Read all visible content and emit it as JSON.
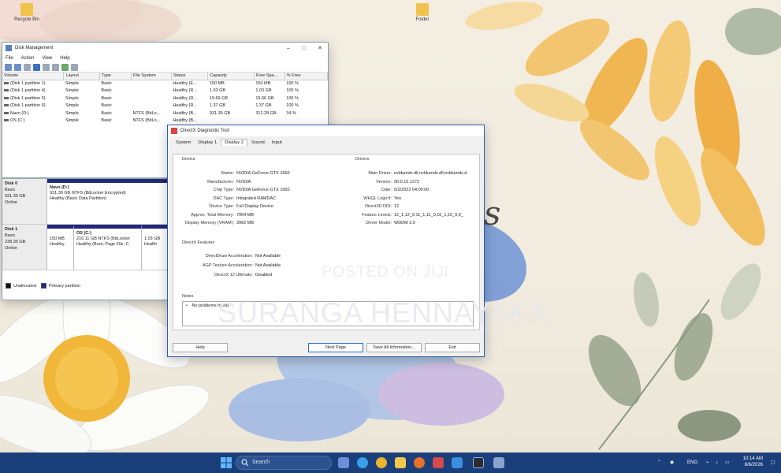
{
  "desktop": {
    "icons": [
      {
        "label": "Recycle Bin",
        "icon": "recycle-bin-icon"
      },
      {
        "label": "Folder",
        "icon": "folder-icon"
      }
    ],
    "wallpaper_text": "ts",
    "watermark_posted": "POSTED ON JIJI",
    "watermark_name": "SURANGA HENNAYAKA"
  },
  "disk_management": {
    "title": "Disk Management",
    "menu": [
      "File",
      "Action",
      "View",
      "Help"
    ],
    "columns": [
      "Volume",
      "Layout",
      "Type",
      "File System",
      "Status",
      "Capacity",
      "Free Spa...",
      "% Free"
    ],
    "rows": [
      [
        "(Disk 1 partition 1)",
        "Simple",
        "Basic",
        "",
        "Healthy (E...",
        "150 MB",
        "150 MB",
        "100 %"
      ],
      [
        "(Disk 1 partition 4)",
        "Simple",
        "Basic",
        "",
        "Healthy (R...",
        "1.03 GB",
        "1.03 GB",
        "100 %"
      ],
      [
        "(Disk 1 partition 5)",
        "Simple",
        "Basic",
        "",
        "Healthy (R...",
        "19.66 GB",
        "19.66 GB",
        "100 %"
      ],
      [
        "(Disk 1 partition 6)",
        "Simple",
        "Basic",
        "",
        "Healthy (R...",
        "1.37 GB",
        "1.37 GB",
        "100 %"
      ],
      [
        "Navo (D:)",
        "Simple",
        "Basic",
        "NTFS (BitLo...",
        "Healthy (B...",
        "931.39 GB",
        "312.28 GB",
        "34 %"
      ],
      [
        "OS (C:)",
        "Simple",
        "Basic",
        "NTFS (BitLo...",
        "Healthy (B...",
        "",
        "",
        ""
      ]
    ],
    "disk0": {
      "name": "Disk 0",
      "type": "Basic",
      "size": "931.39 GB",
      "state": "Online",
      "part_name": "Navo (D:)",
      "part_size": "931.39 GB NTFS (BitLocker Encrypted)",
      "part_status": "Healthy (Basic Data Partition)"
    },
    "disk1": {
      "name": "Disk 1",
      "type": "Basic",
      "size": "238.35 GB",
      "state": "Online",
      "p1_size": "150 MB",
      "p1_status": "Healthy",
      "p2_name": "OS (C:)",
      "p2_size": "216.11 GB NTFS (BitLocker",
      "p2_status": "Healthy (Boot, Page File, C",
      "p3_size": "1.03 GB",
      "p3_status": "Health"
    },
    "legend": [
      "Unallocated",
      "Primary partition"
    ]
  },
  "dxdiag": {
    "title": "DirectX Diagnostic Tool",
    "tabs": [
      "System",
      "Display 1",
      "Display 2",
      "Sound",
      "Input"
    ],
    "active_tab": "Display 2",
    "device_title": "Device",
    "drivers_title": "Drivers",
    "device": [
      {
        "k": "Name:",
        "v": "NVIDIA GeForce GTX 1650"
      },
      {
        "k": "Manufacturer:",
        "v": "NVIDIA"
      },
      {
        "k": "Chip Type:",
        "v": "NVIDIA GeForce GTX 1650"
      },
      {
        "k": "DAC Type:",
        "v": "Integrated RAMDAC"
      },
      {
        "k": "Device Type:",
        "v": "Full Display Device"
      },
      {
        "k": "Approx. Total Memory:",
        "v": "7954 MB"
      },
      {
        "k": "Display Memory (VRAM):",
        "v": "3962 MB"
      }
    ],
    "drivers": [
      {
        "k": "Main Driver:",
        "v": "nvldumdx.dll,nvldumdx.dll,nvldumdx.d"
      },
      {
        "k": "Version:",
        "v": "30.0.15.1272"
      },
      {
        "k": "Date:",
        "v": "5/2/2022 04:00:00"
      },
      {
        "k": "WHQL Logo'd:",
        "v": "Yes"
      },
      {
        "k": "Direct3D DDI:",
        "v": "12"
      },
      {
        "k": "Feature Levels:",
        "v": "12_1,12_0,11_1,11_0,10_1,10_0,9_"
      },
      {
        "k": "Driver Model:",
        "v": "WDDM 3.0"
      }
    ],
    "directx_features_title": "DirectX Features",
    "features": [
      {
        "k": "DirectDraw Acceleration:",
        "v": "Not Available"
      },
      {
        "k": "AGP Texture Acceleration:",
        "v": "Not Available"
      },
      {
        "k": "DirectX 12 Ultimate:",
        "v": "Disabled"
      }
    ],
    "notes_title": "Notes",
    "notes_text": "No problems found.",
    "buttons": {
      "help": "Help",
      "next": "Next Page",
      "save": "Save All Information...",
      "exit": "Exit"
    }
  },
  "taskbar": {
    "search_placeholder": "Search",
    "apps": [
      "widgets-icon",
      "edge-icon",
      "chrome-icon",
      "file-explorer-icon",
      "firefox-icon",
      "store-icon",
      "media-icon",
      "xbox-icon",
      "app-icon"
    ],
    "lang": "ENG",
    "time": "10:14 AM",
    "date": "8/6/2026"
  },
  "colors": {
    "taskbar": "#1b3f7a",
    "primary_partition": "#1f2a7a",
    "dx_border": "#2a5db0"
  }
}
